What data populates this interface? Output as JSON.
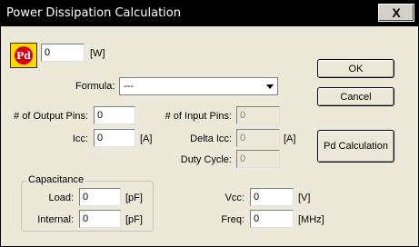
{
  "window": {
    "title": "Power Dissipation Calculation",
    "close_label": "X"
  },
  "power": {
    "icon_text": "Pd",
    "value": "0",
    "unit": "[W]"
  },
  "formula": {
    "label": "Formula:",
    "value": "---"
  },
  "buttons": {
    "ok": "OK",
    "cancel": "Cancel",
    "pd_calc": "Pd Calculation"
  },
  "fields": {
    "output_pins": {
      "label": "# of Output Pins:",
      "value": "0"
    },
    "input_pins": {
      "label": "# of Input Pins:",
      "value": "0"
    },
    "icc": {
      "label": "Icc:",
      "value": "0",
      "unit": "[A]"
    },
    "delta_icc": {
      "label": "Delta Icc:",
      "value": "0",
      "unit": "[A]"
    },
    "duty_cycle": {
      "label": "Duty Cycle:",
      "value": "0"
    },
    "vcc": {
      "label": "Vcc:",
      "value": "0",
      "unit": "[V]"
    },
    "freq": {
      "label": "Freq:",
      "value": "0",
      "unit": "[MHz]"
    }
  },
  "capacitance": {
    "title": "Capacitance",
    "load": {
      "label": "Load:",
      "value": "0",
      "unit": "[pF]"
    },
    "internal": {
      "label": "Internal:",
      "value": "0",
      "unit": "[pF]"
    }
  }
}
